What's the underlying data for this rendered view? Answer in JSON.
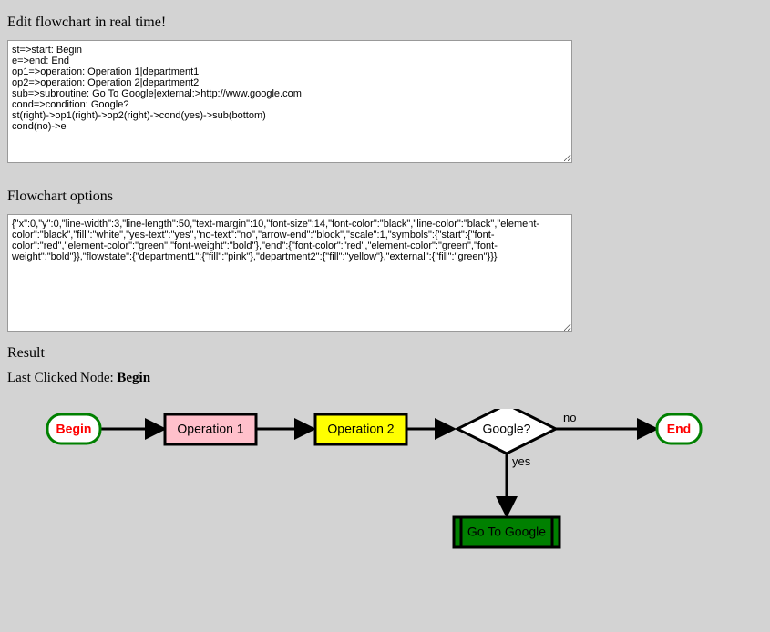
{
  "headings": {
    "edit": "Edit flowchart in real time!",
    "options": "Flowchart options",
    "result": "Result"
  },
  "lastClicked": {
    "prefix": "Last Clicked Node: ",
    "value": "Begin"
  },
  "textareas": {
    "code": "st=>start: Begin\ne=>end: End\nop1=>operation: Operation 1|department1\nop2=>operation: Operation 2|department2\nsub=>subroutine: Go To Google|external:>http://www.google.com\ncond=>condition: Google?\nst(right)->op1(right)->op2(right)->cond(yes)->sub(bottom)\ncond(no)->e",
    "options": "{\"x\":0,\"y\":0,\"line-width\":3,\"line-length\":50,\"text-margin\":10,\"font-size\":14,\"font-color\":\"black\",\"line-color\":\"black\",\"element-color\":\"black\",\"fill\":\"white\",\"yes-text\":\"yes\",\"no-text\":\"no\",\"arrow-end\":\"block\",\"scale\":1,\"symbols\":{\"start\":{\"font-color\":\"red\",\"element-color\":\"green\",\"font-weight\":\"bold\"},\"end\":{\"font-color\":\"red\",\"element-color\":\"green\",\"font-weight\":\"bold\"}},\"flowstate\":{\"department1\":{\"fill\":\"pink\"},\"department2\":{\"fill\":\"yellow\"},\"external\":{\"fill\":\"green\"}}}"
  },
  "chart_data": {
    "type": "flowchart",
    "nodes": [
      {
        "id": "st",
        "kind": "start",
        "label": "Begin",
        "fill": "white",
        "stroke": "green",
        "textColor": "red",
        "bold": true
      },
      {
        "id": "op1",
        "kind": "operation",
        "label": "Operation 1",
        "fill": "pink",
        "stroke": "black",
        "textColor": "black",
        "bold": false
      },
      {
        "id": "op2",
        "kind": "operation",
        "label": "Operation 2",
        "fill": "yellow",
        "stroke": "black",
        "textColor": "black",
        "bold": false
      },
      {
        "id": "cond",
        "kind": "condition",
        "label": "Google?",
        "fill": "white",
        "stroke": "black",
        "textColor": "black",
        "bold": false
      },
      {
        "id": "e",
        "kind": "end",
        "label": "End",
        "fill": "white",
        "stroke": "green",
        "textColor": "red",
        "bold": true
      },
      {
        "id": "sub",
        "kind": "subroutine",
        "label": "Go To Google",
        "fill": "green",
        "stroke": "black",
        "textColor": "black",
        "bold": false
      }
    ],
    "edges": [
      {
        "from": "st",
        "to": "op1"
      },
      {
        "from": "op1",
        "to": "op2"
      },
      {
        "from": "op2",
        "to": "cond"
      },
      {
        "from": "cond",
        "to": "sub",
        "label": "yes",
        "dir": "bottom"
      },
      {
        "from": "cond",
        "to": "e",
        "label": "no",
        "dir": "right"
      }
    ]
  }
}
